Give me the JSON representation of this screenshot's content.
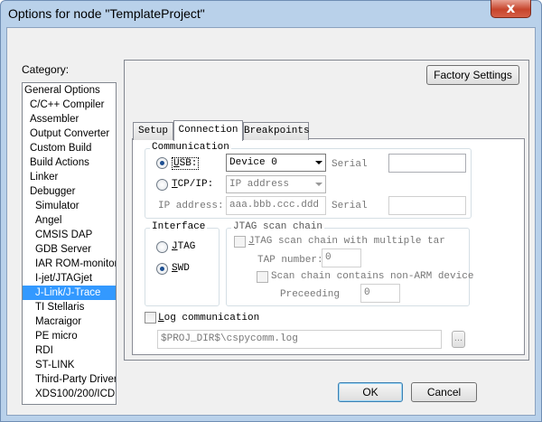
{
  "window": {
    "title": "Options for node \"TemplateProject\"",
    "close_glyph": "x"
  },
  "category": {
    "label": "Category:",
    "items": [
      "General Options",
      "C/C++ Compiler",
      "Assembler",
      "Output Converter",
      "Custom Build",
      "Build Actions",
      "Linker",
      "Debugger",
      "Simulator",
      "Angel",
      "CMSIS DAP",
      "GDB Server",
      "IAR ROM-monitor",
      "I-jet/JTAGjet",
      "J-Link/J-Trace",
      "TI Stellaris",
      "Macraigor",
      "PE micro",
      "RDI",
      "ST-LINK",
      "Third-Party Driver",
      "XDS100/200/ICDI"
    ],
    "selected": "J-Link/J-Trace"
  },
  "factory_settings": "Factory Settings",
  "tabs": [
    "Setup",
    "Connection",
    "Breakpoints"
  ],
  "active_tab": "Connection",
  "communication": {
    "title": "Communication",
    "usb": {
      "prefix": "",
      "underline": "U",
      "rest": "SB:",
      "checked": true
    },
    "usb_device": "Device 0",
    "serial_label": "Serial",
    "tcpip": {
      "underline": "T",
      "rest": "CP/IP:",
      "checked": false
    },
    "tcpip_mode": "IP address",
    "ip_label": "IP address:",
    "ip_value": "aaa.bbb.ccc.ddd",
    "serial_label_2": "Serial"
  },
  "interface": {
    "title": "Interface",
    "jtag": {
      "underline": "J",
      "rest": "TAG",
      "checked": false
    },
    "swd": {
      "underline": "S",
      "rest": "WD",
      "checked": true
    }
  },
  "jtag_scan_chain": {
    "title": "JTAG scan chain",
    "multiple_tap_label_underline": "J",
    "multiple_tap_label_rest": "TAG scan chain with multiple tar",
    "tap_number_label": "TAP number:",
    "tap_number_value": "0",
    "non_arm_label": "Scan chain contains non-ARM device",
    "preceeding_label": "Preceeding",
    "preceeding_value": "0"
  },
  "log": {
    "label_underline": "L",
    "label_rest": "og communication",
    "checked": false,
    "path": "$PROJ_DIR$\\cspycomm.log",
    "browse": "..."
  },
  "buttons": {
    "ok": "OK",
    "cancel": "Cancel"
  }
}
